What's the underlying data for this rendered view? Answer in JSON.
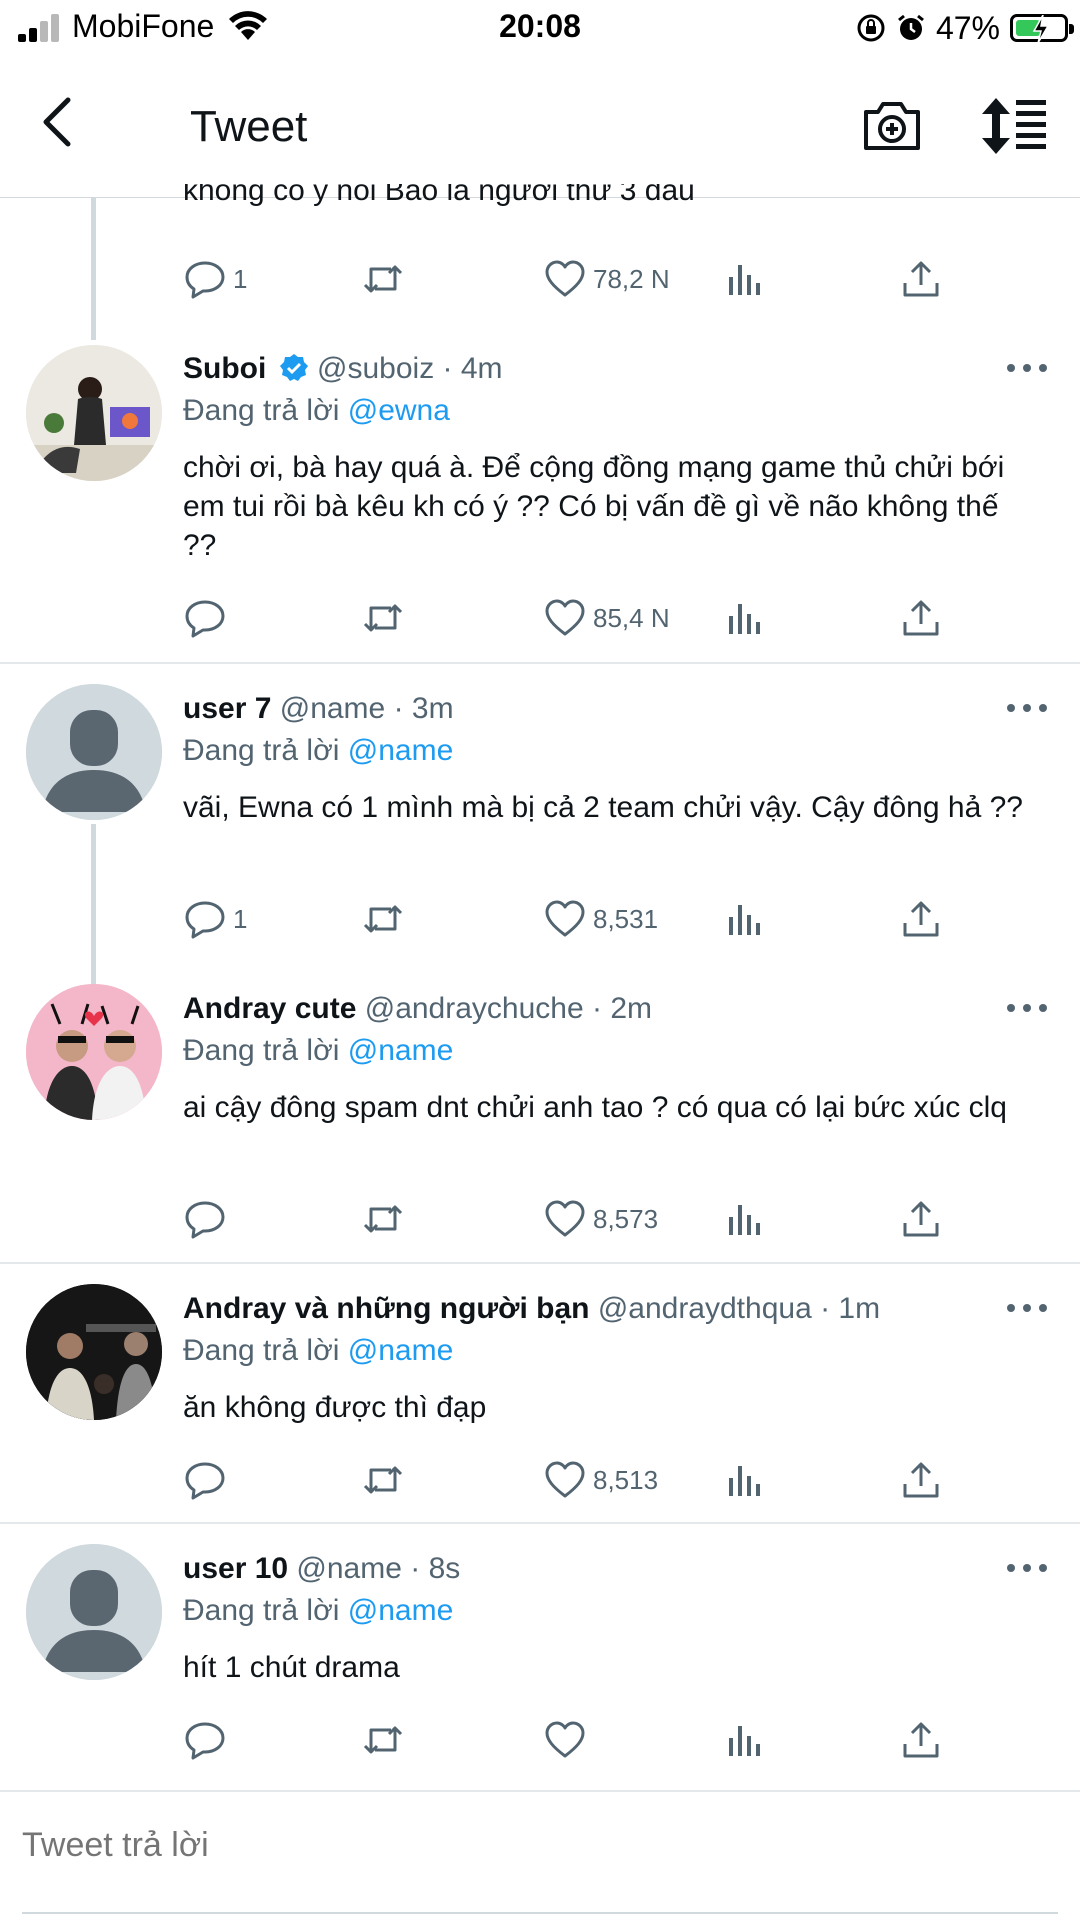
{
  "status_bar": {
    "carrier": "MobiFone",
    "time": "20:08",
    "battery": "47%",
    "battery_level": 0.47
  },
  "header": {
    "title": "Tweet"
  },
  "previous_tweet": {
    "text_tail": "không có ý nói Bảo là người thứ 3 đâu",
    "reply_count": "1",
    "like_count": "78,2 N"
  },
  "tweets": [
    {
      "name": "Suboi",
      "verified": true,
      "handle": "@suboiz",
      "time": "· 4m",
      "replying_label": "Đang trả lời",
      "replying_to": "@ewna",
      "text": "chời ơi, bà hay quá à. Để cộng đồng mạng game thủ chửi bới em tui rồi bà kêu kh có ý ?? Có bị vấn đề gì về não không thế ??",
      "reply_count": "",
      "like_count": "85,4 N"
    },
    {
      "name": "user 7",
      "handle": "@name",
      "time": "· 3m",
      "replying_label": "Đang trả lời",
      "replying_to": "@name",
      "text": "vãi, Ewna có 1 mình mà bị cả 2 team chửi vậy. Cậy đông hả ??",
      "reply_count": "1",
      "like_count": "8,531"
    },
    {
      "name": "Andray cute",
      "handle": "@andraychuche",
      "time": "· 2m",
      "replying_label": "Đang trả lời",
      "replying_to": "@name",
      "text": "ai cậy đông spam dnt chửi anh tao ? có qua có lại bức xúc clq",
      "reply_count": "",
      "like_count": "8,573"
    },
    {
      "name": "Andray và những người bạn",
      "handle": "@andraydthqua",
      "time": "· 1m",
      "replying_label": "Đang trả lời",
      "replying_to": "@name",
      "text": "ăn không được thì đạp",
      "reply_count": "",
      "like_count": "8,513"
    },
    {
      "name": "user 10",
      "handle": "@name",
      "time": "· 8s",
      "replying_label": "Đang trả lời",
      "replying_to": "@name",
      "text": "hít 1 chút drama",
      "reply_count": "",
      "like_count": ""
    }
  ],
  "reply_box": {
    "placeholder": "Tweet trả lời"
  },
  "colors": {
    "accent": "#1d9bf0",
    "muted": "#536471",
    "divider": "#e4e8eb",
    "battery_fill": "#34c759"
  },
  "icons": [
    "back-arrow-icon",
    "camera-plus-icon",
    "sort-icon",
    "reply-icon",
    "retweet-icon",
    "heart-icon",
    "stats-icon",
    "share-icon",
    "more-icon",
    "verified-icon",
    "default-avatar-icon"
  ]
}
